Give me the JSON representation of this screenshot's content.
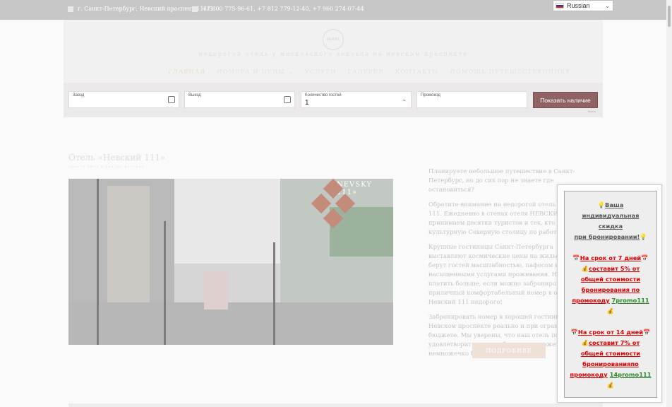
{
  "topbar": {
    "address": "г. Санкт-Петербург, Невский проспект 111/3",
    "phones": "+7 800 775-96-61, +7 812 779-12-40, +7 960 274-07-44"
  },
  "language": {
    "selected": "Russian"
  },
  "header": {
    "logo_text": "HOTEL",
    "tagline": "недорогой отель у московского вокзала на невском проспекте",
    "nav": [
      "ГЛАВНАЯ",
      "НОМЕРА И ЦЕНЫ",
      "УСЛУГИ",
      "ГАЛЕРЕЯ",
      "КОНТАКТЫ",
      "ПОМОЩЬ ПУТЕШЕСТВЕННИКУ"
    ]
  },
  "booking": {
    "checkin_label": "Заезд",
    "checkout_label": "Выезд",
    "guests_label": "Количество гостей",
    "guests_value": "1",
    "promo_label": "Промокод",
    "submit": "Показать наличие",
    "powered": "Bnovo"
  },
  "main": {
    "title": "Отель «Невский 111»",
    "subtitle": "просто быть в центре истории",
    "photo_label": "NEVSKY 111»",
    "paragraphs": [
      "Планируете небольшое путешествие в Санкт-Петербург, но до сих пор не знаете где остановиться?",
      "Обратите внимание на недорогой отель Невский 111. Ежедневно в стенах отеля НЕВСКИЙ 111 мы принимаем десятки туристов и тех, кто приехал в культурную Северную столицу по работе.",
      "Крупные гостиницы Санкт-Петербурга выставляют космические цены на жильё. Они берут гостей масштабностью, пафосом и насыщенными услугами проживания. Но зачем платить больше, если можно забронировать приличный комфортабельный номер в отеле Невский 111 недорого!",
      "Забронировать номер в хорошей гостинице на Невском проспекте реально и при ограниченном бюджете. Мы уверены, что наш отель полностью удовлетворит ваши требования и, может, даже немножечко больше."
    ],
    "detail_button": "ПОДРОБНЕЕ"
  },
  "popup": {
    "line1": "Ваша",
    "line2": "индивидуальная",
    "line3": "скидка",
    "line4": "при бронировании!",
    "offer1_head": "На срок от 7 дней",
    "offer1_l1": "составит 5% от",
    "offer1_l2": "общей стоимости",
    "offer1_l3": "бронирования по",
    "offer1_l4": "промокоду",
    "offer1_code": "7promo111",
    "offer2_head": "На срок от 14 дней",
    "offer2_l1": "составит 7% от",
    "offer2_l2": "общей стоимости",
    "offer2_l3": "бронированияпо",
    "offer2_l4": "промокоду",
    "offer2_code": "14promo111"
  },
  "colors": {
    "topbar": "#c7c7c7",
    "button": "#8f6363",
    "popup_red": "#e00000",
    "popup_green": "#2a8a2a"
  }
}
